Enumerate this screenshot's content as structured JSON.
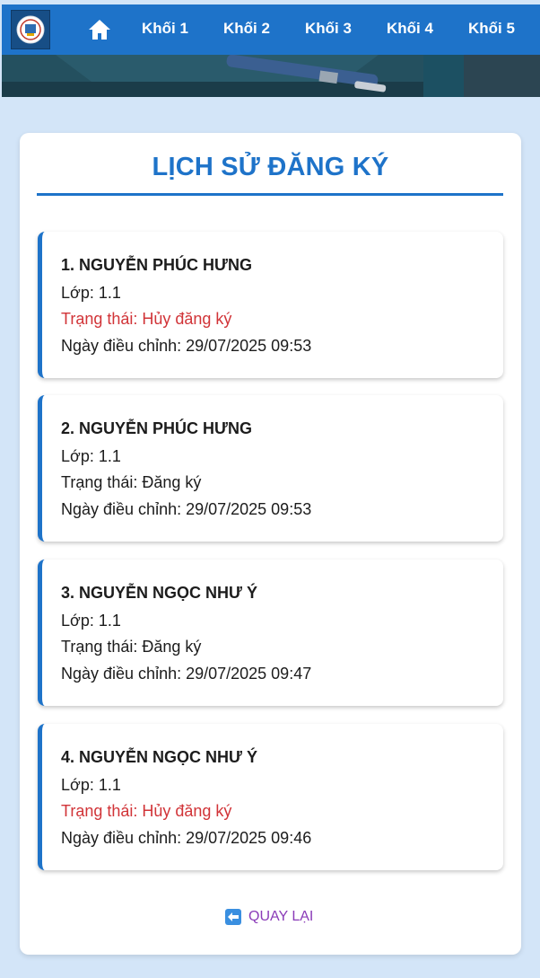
{
  "nav": {
    "logo_icon": "school-logo-icon",
    "home_icon": "home-icon",
    "items": [
      "Khối 1",
      "Khối 2",
      "Khối 3",
      "Khối 4",
      "Khối 5"
    ],
    "background": "#1e73c9"
  },
  "page": {
    "title": "LỊCH SỬ ĐĂNG KÝ",
    "accent": "#1e73c9",
    "cancel_color": "#d13438"
  },
  "entries": [
    {
      "name": "1. NGUYỄN PHÚC HƯNG",
      "class_line": "Lớp: 1.1",
      "status_line": "Trạng thái: Hủy đăng ký",
      "date_line": "Ngày điều chỉnh: 29/07/2025 09:53",
      "cancelled": true
    },
    {
      "name": "2. NGUYỄN PHÚC HƯNG",
      "class_line": "Lớp: 1.1",
      "status_line": "Trạng thái: Đăng ký",
      "date_line": "Ngày điều chỉnh: 29/07/2025 09:53",
      "cancelled": false
    },
    {
      "name": "3. NGUYỄN NGỌC NHƯ Ý",
      "class_line": "Lớp: 1.1",
      "status_line": "Trạng thái: Đăng ký",
      "date_line": "Ngày điều chỉnh: 29/07/2025 09:47",
      "cancelled": false
    },
    {
      "name": "4. NGUYỄN NGỌC NHƯ Ý",
      "class_line": "Lớp: 1.1",
      "status_line": "Trạng thái: Hủy đăng ký",
      "date_line": "Ngày điều chỉnh: 29/07/2025 09:46",
      "cancelled": true
    }
  ],
  "back": {
    "label": "QUAY LẠI",
    "icon": "back-arrow-icon"
  }
}
